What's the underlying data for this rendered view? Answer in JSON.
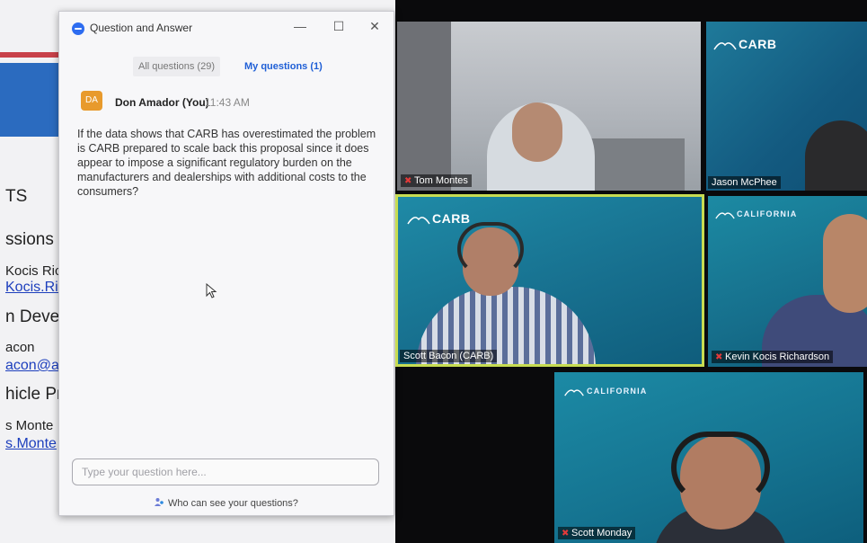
{
  "slide": {
    "lines": [
      "TS",
      "ssions N",
      "Kocis Ric",
      "Kocis.Rich",
      "n Devel",
      "acon",
      "acon@a",
      "hicle Pro",
      "s Monte",
      "s.Monte"
    ]
  },
  "qa_window": {
    "title": "Question and Answer",
    "tabs": [
      {
        "label": "All questions (29)",
        "active": false
      },
      {
        "label": "My questions (1)",
        "active": true
      }
    ],
    "question": {
      "avatar_initials": "DA",
      "author": "Don Amador (You)",
      "time": "11:43 AM",
      "text": "If the data shows that CARB has overestimated the problem is CARB prepared to scale back this proposal since it does appear to impose a significant regulatory burden on the manufacturers and dealerships with additional costs to the consumers?"
    },
    "input_placeholder": "Type your question here...",
    "footer_link": "Who can see your questions?"
  },
  "participants": [
    {
      "name": "Tom Montes",
      "muted": true
    },
    {
      "name": "Jason McPhee",
      "muted": false
    },
    {
      "name": "Scott Bacon (CARB)",
      "muted": false,
      "active_speaker": true
    },
    {
      "name": "Kevin Kocis Richardson",
      "muted": true
    },
    {
      "name": "Scott Monday",
      "muted": true
    }
  ],
  "branding": {
    "carb": "CARB",
    "california": "CALIFORNIA"
  },
  "colors": {
    "accent_blue": "#1f5fd6",
    "active_speaker_border": "#c7dc52",
    "avatar_orange": "#e89a2c",
    "muted_red": "#e43a3a"
  }
}
